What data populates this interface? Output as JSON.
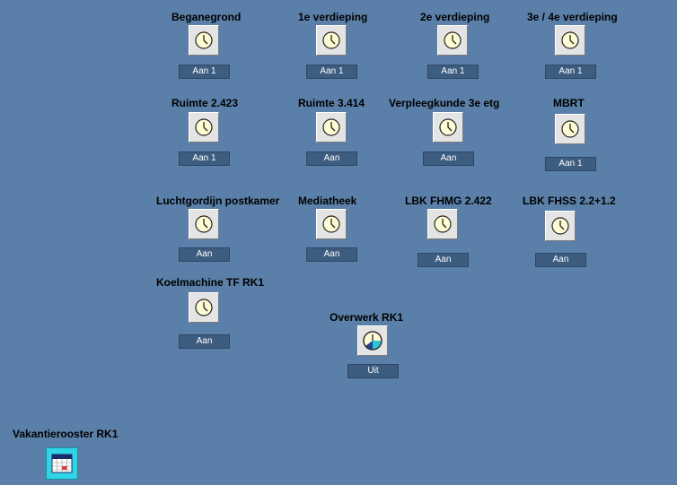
{
  "schedules": [
    {
      "label": "Beganegrond",
      "status": "Aan 1"
    },
    {
      "label": "1e verdieping",
      "status": "Aan 1"
    },
    {
      "label": "2e verdieping",
      "status": "Aan 1"
    },
    {
      "label": "3e / 4e verdieping",
      "status": "Aan 1"
    },
    {
      "label": "Ruimte 2.423",
      "status": "Aan 1"
    },
    {
      "label": "Ruimte 3.414",
      "status": "Aan"
    },
    {
      "label": "Verpleegkunde 3e etg",
      "status": "Aan"
    },
    {
      "label": "MBRT",
      "status": "Aan 1"
    },
    {
      "label": "Luchtgordijn postkamer",
      "status": "Aan"
    },
    {
      "label": "Mediatheek",
      "status": "Aan"
    },
    {
      "label": "LBK FHMG 2.422",
      "status": "Aan"
    },
    {
      "label": "LBK FHSS 2.2+1.2",
      "status": "Aan"
    },
    {
      "label": "Koelmachine TF RK1",
      "status": "Aan"
    }
  ],
  "overwork": {
    "label": "Overwerk RK1",
    "status": "Uit",
    "icon": "pie-clock-icon"
  },
  "vacation": {
    "label": "Vakantierooster RK1",
    "icon": "calendar-icon"
  },
  "colors": {
    "background": "#5a7fa8",
    "status_bg": "#3c5c80",
    "calendar_bg": "#2fd4e6",
    "overwork_accent": "#29c4d8"
  }
}
